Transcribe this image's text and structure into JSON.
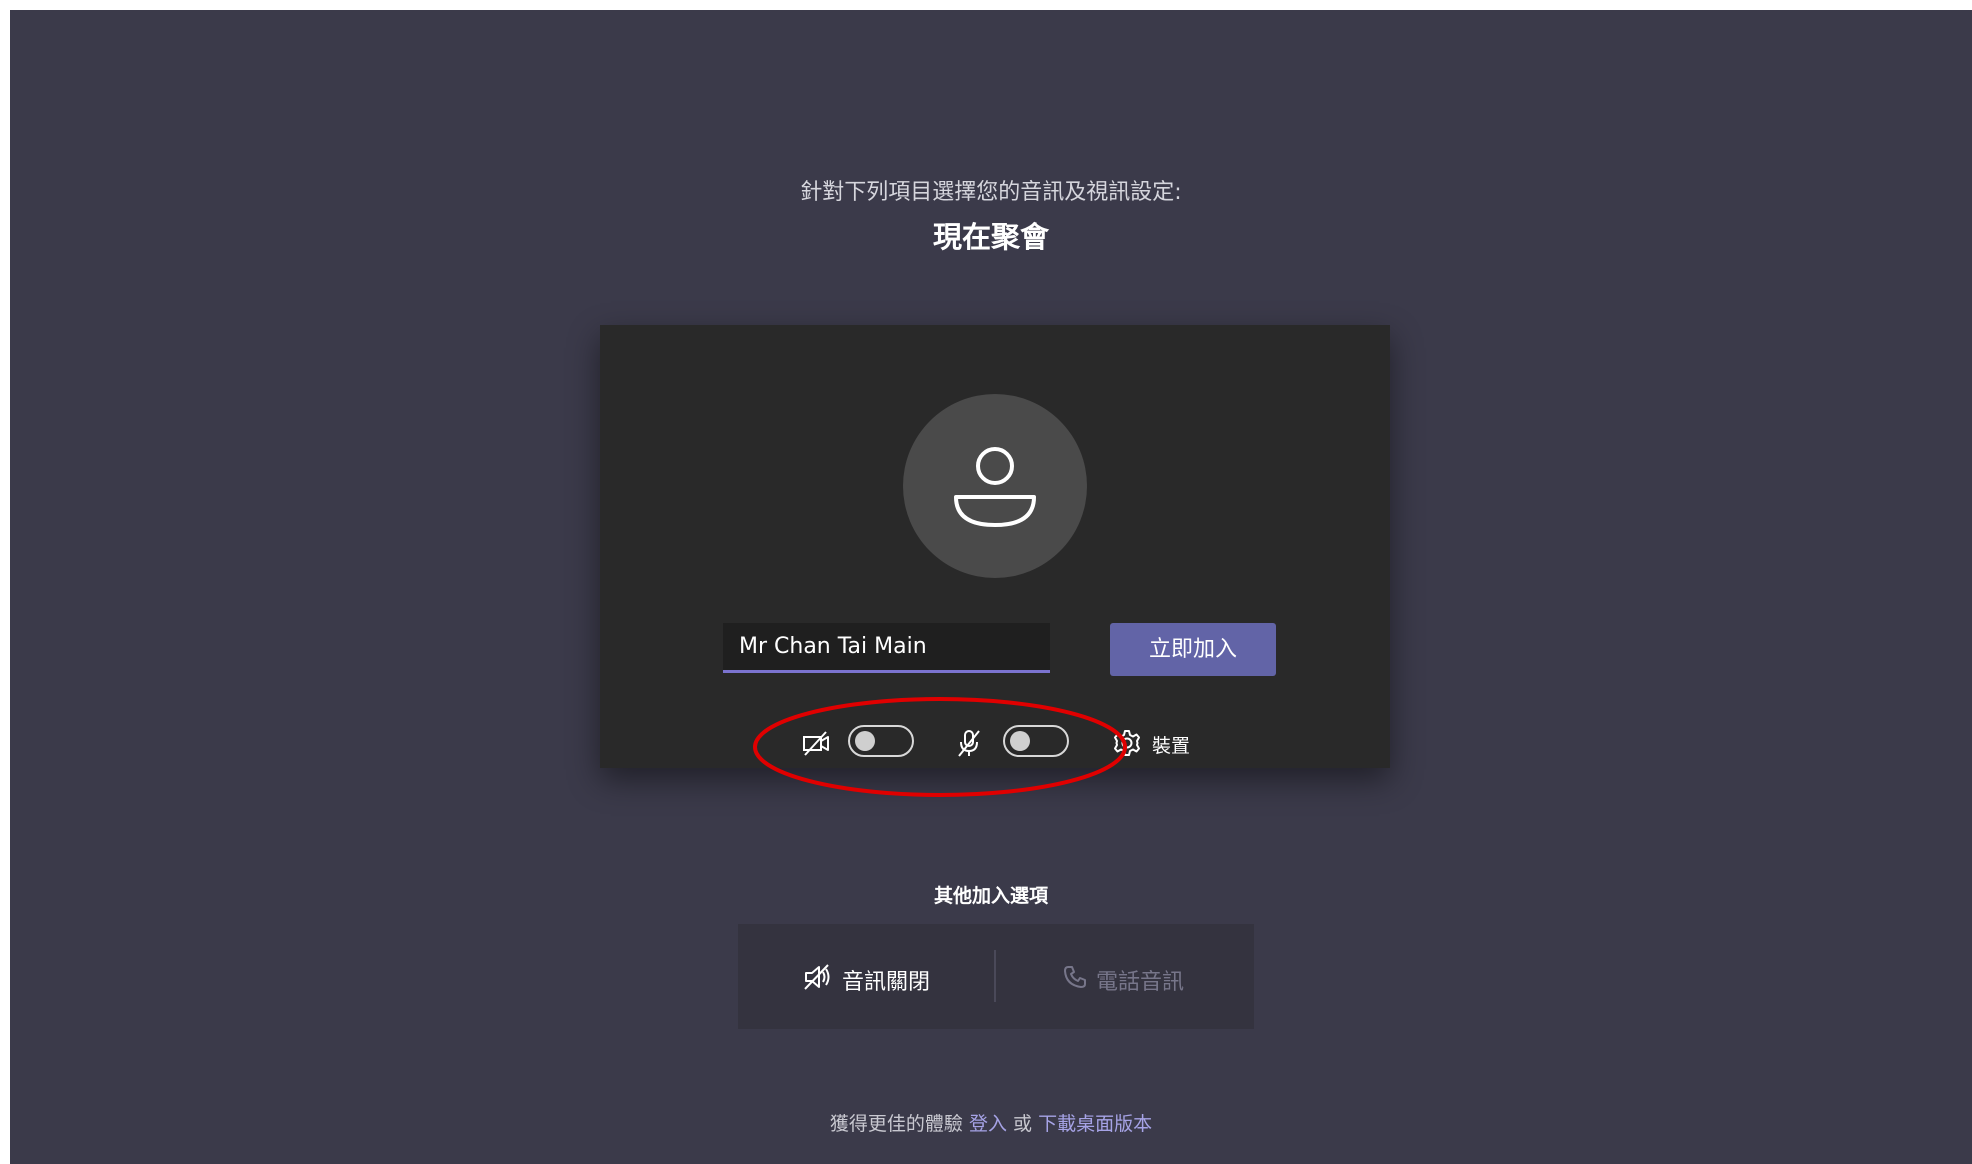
{
  "header": {
    "subtitle": "針對下列項目選擇您的音訊及視訊設定:",
    "meeting_title": "現在聚會"
  },
  "preview": {
    "name_value": "Mr Chan Tai Main",
    "join_label": "立即加入",
    "camera_icon": "camera-off-icon",
    "camera_toggle_on": false,
    "mic_icon": "mic-off-icon",
    "mic_toggle_on": false,
    "devices_icon": "gear-icon",
    "devices_label": "裝置"
  },
  "other_options": {
    "title": "其他加入選項",
    "audio_off_label": "音訊關閉",
    "audio_off_icon": "speaker-off-icon",
    "phone_audio_label": "電話音訊",
    "phone_audio_icon": "phone-icon"
  },
  "footer": {
    "prefix": "獲得更佳的體驗",
    "sign_in_link": "登入",
    "or_text": "或",
    "download_link": "下載桌面版本"
  },
  "colors": {
    "background": "#3b3a4a",
    "preview_panel": "#292929",
    "accent": "#6264a7",
    "link": "#a6a3e6",
    "annotation_circle": "#e00000"
  }
}
